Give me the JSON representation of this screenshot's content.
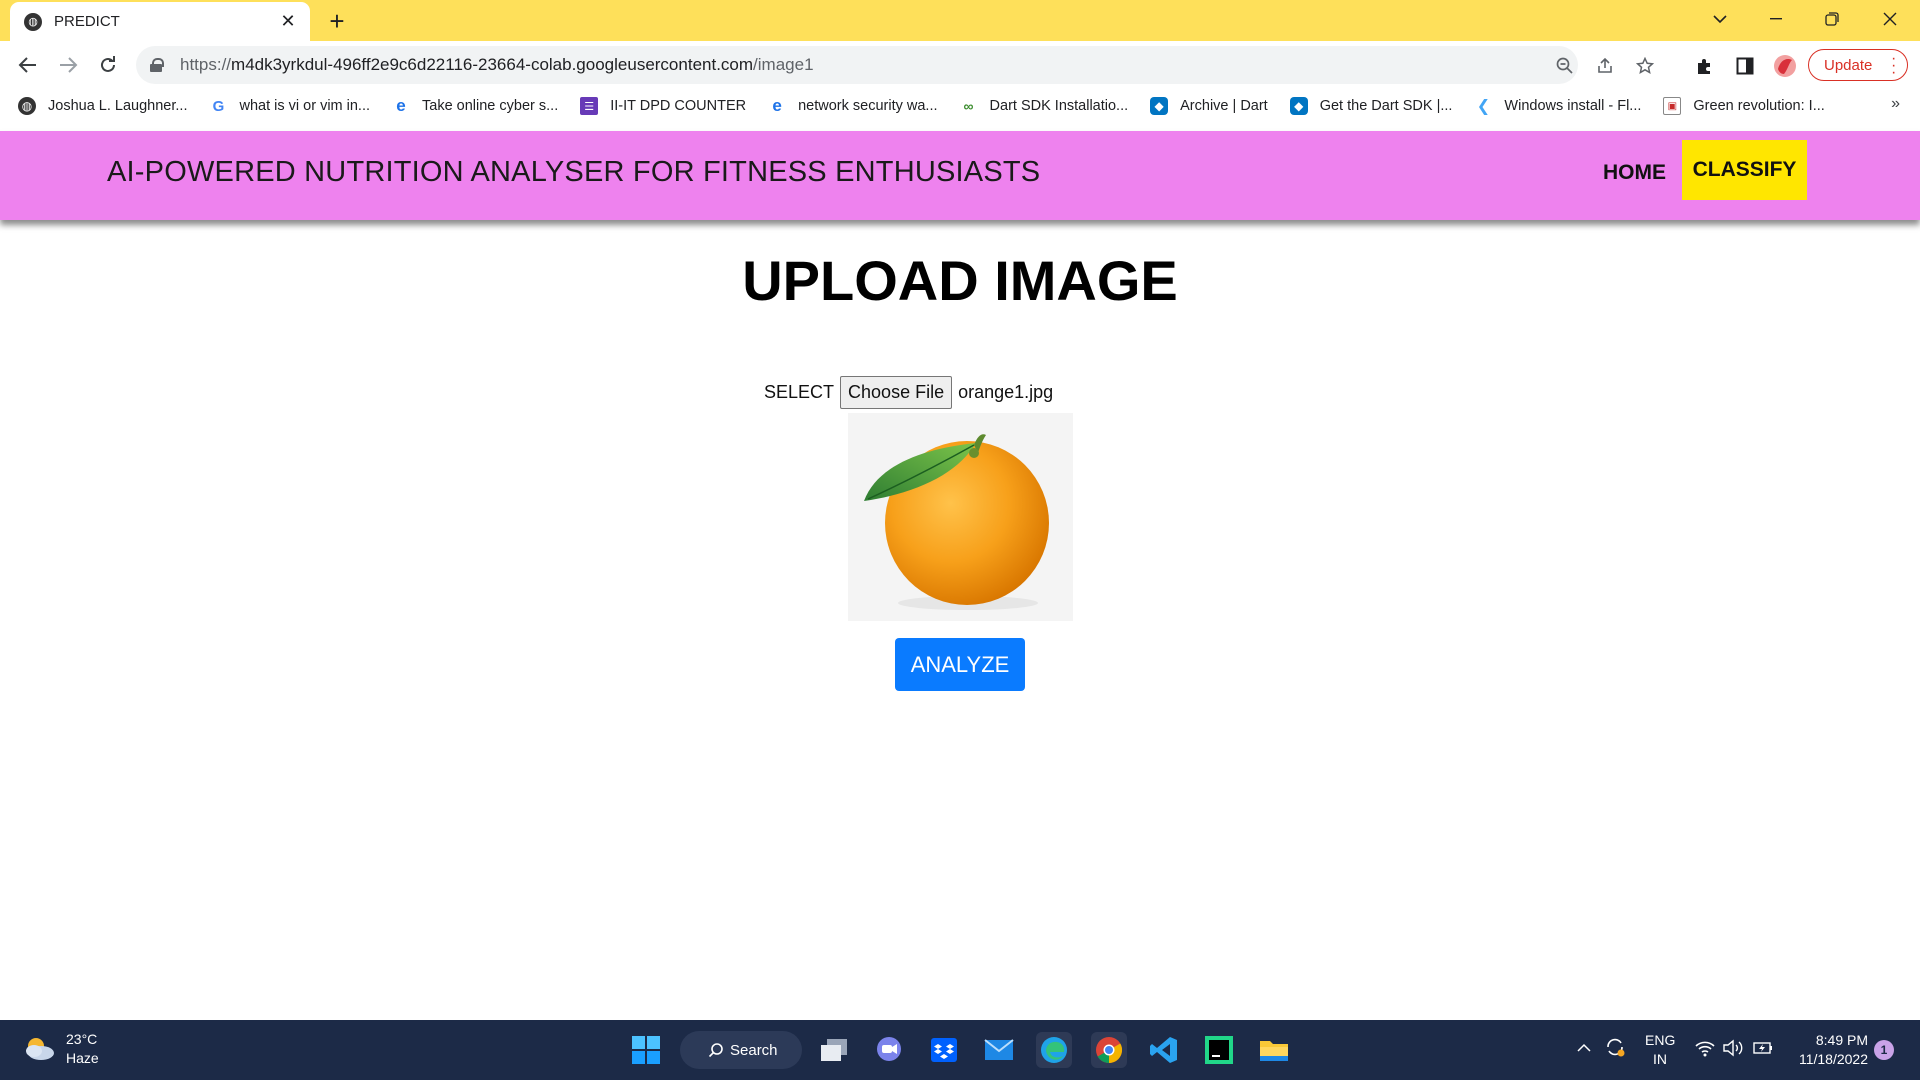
{
  "browser": {
    "tab_title": "PREDICT",
    "url_prefix": "https://",
    "url_host": "m4dk3yrkdul-496ff2e9c6d22116-23664-colab.googleusercontent.com",
    "url_path": "/image1",
    "update_label": "Update",
    "accent_color": "#fee05a"
  },
  "bookmarks": [
    {
      "label": "Joshua L. Laughner...",
      "icon": "globe-icon"
    },
    {
      "label": "what is vi or vim in...",
      "icon": "google-icon"
    },
    {
      "label": "Take online cyber s...",
      "icon": "edge-e-icon"
    },
    {
      "label": "II-IT DPD COUNTER",
      "icon": "forms-icon"
    },
    {
      "label": "network security wa...",
      "icon": "edge-e-icon"
    },
    {
      "label": "Dart SDK Installatio...",
      "icon": "link-icon"
    },
    {
      "label": "Archive | Dart",
      "icon": "dart-icon"
    },
    {
      "label": "Get the Dart SDK |...",
      "icon": "dart-icon"
    },
    {
      "label": "Windows install - Fl...",
      "icon": "flutter-icon"
    },
    {
      "label": "Green revolution: I...",
      "icon": "slides-icon"
    }
  ],
  "site": {
    "brand": "AI-POWERED NUTRITION ANALYSER FOR FITNESS ENTHUSIASTS",
    "nav_home": "HOME",
    "nav_classify": "CLASSIFY",
    "navbar_color": "#ee82ee",
    "classify_color": "#ffe600"
  },
  "upload": {
    "title": "UPLOAD IMAGE",
    "select_label": "SELECT",
    "choose_file_label": "Choose File",
    "file_name": "orange1.jpg",
    "analyze_label": "ANALYZE",
    "analyze_color": "#0a7bff"
  },
  "taskbar": {
    "temperature": "23°C",
    "weather": "Haze",
    "search_label": "Search",
    "lang_top": "ENG",
    "lang_bottom": "IN",
    "time": "8:49 PM",
    "date": "11/18/2022",
    "notification_count": "1"
  }
}
